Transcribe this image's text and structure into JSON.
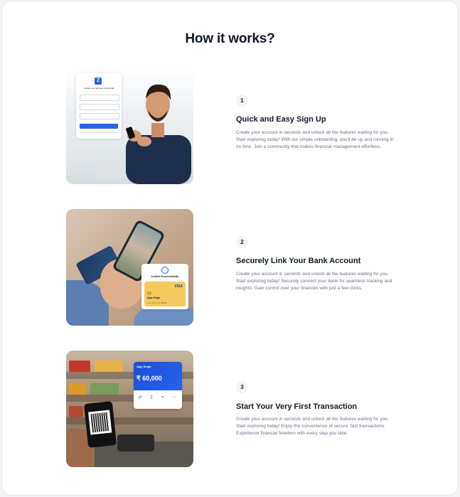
{
  "page": {
    "title": "How it works?"
  },
  "colors": {
    "accent": "#2563eb",
    "heading": "#111827",
    "body": "#6b7280",
    "badge_bg": "#f3f4f6"
  },
  "steps": [
    {
      "number": "1",
      "heading": "Quick and Easy Sign Up",
      "description": "Create your account in seconds and unlock all the features waiting for you. Start exploring today! With our simple onboarding, you'll be up and running in no time. Join a community that makes financial management effortless.",
      "mockup": {
        "logo": "Z",
        "caption": "Create your account in seconds"
      }
    },
    {
      "number": "2",
      "heading": "Securely Link Your Bank Account",
      "description": "Create your account in seconds and unlock all the features waiting for you. Start exploring today! Securely connect your bank for seamless tracking and insights. Gain control over your finances with just a few clicks.",
      "mockup": {
        "status": "Linked Successfully",
        "card_brand": "VISA",
        "card_holder": "Ajay Singh",
        "card_number": "•••• •••• •••• 6012"
      }
    },
    {
      "number": "3",
      "heading": "Start Your Very First Transaction",
      "description": "Create your account in seconds and unlock all the features waiting for you. Start exploring today! Enjoy the convenience of secure, fast transactions. Experience financial freedom with every step you take.",
      "mockup": {
        "name": "Ajay Singh",
        "balance": "₹ 60,000"
      }
    }
  ]
}
